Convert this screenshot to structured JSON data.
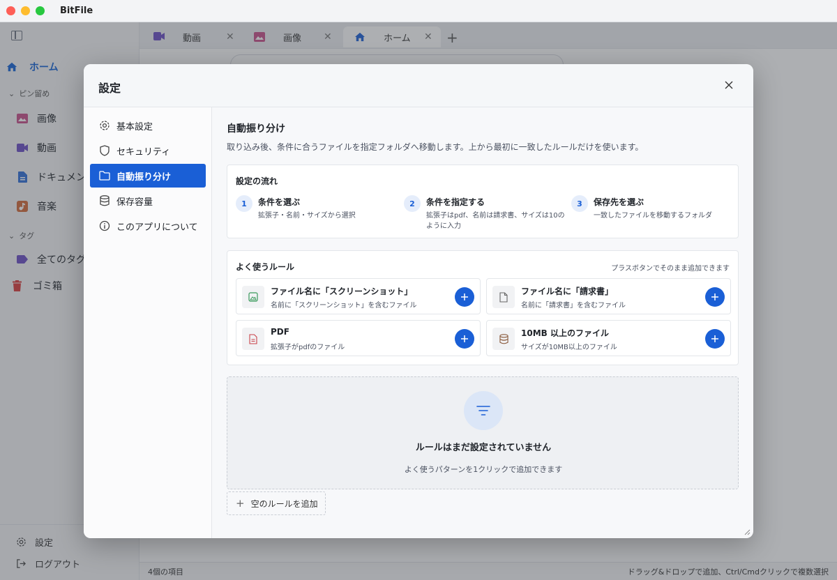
{
  "app": {
    "title": "BitFile"
  },
  "sidebar": {
    "home": "ホーム",
    "pinned_section": "ピン留め",
    "pinned": [
      "画像",
      "動画",
      "ドキュメント",
      "音楽"
    ],
    "tags_section": "タグ",
    "all_tags": "全てのタグ",
    "trash": "ゴミ箱",
    "settings": "設定",
    "logout": "ログアウト"
  },
  "tabs": [
    {
      "label": "動画",
      "icon": "video-icon",
      "color": "#6b4fc4"
    },
    {
      "label": "画像",
      "icon": "image-icon",
      "color": "#c8508a"
    },
    {
      "label": "ホーム",
      "icon": "home-icon",
      "color": "#1a5fd6"
    }
  ],
  "status": {
    "count": "4個の項目",
    "hint": "ドラッグ&ドロップで追加、Ctrl/Cmdクリックで複数選択"
  },
  "settings": {
    "title": "設定",
    "nav": [
      {
        "label": "基本設定",
        "icon": "gear-icon"
      },
      {
        "label": "セキュリティ",
        "icon": "shield-icon"
      },
      {
        "label": "自動振り分け",
        "icon": "folder-icon",
        "active": true
      },
      {
        "label": "保存容量",
        "icon": "database-icon"
      },
      {
        "label": "このアプリについて",
        "icon": "info-icon"
      }
    ],
    "section_title": "自動振り分け",
    "section_desc": "取り込み後、条件に合うファイルを指定フォルダへ移動します。上から最初に一致したルールだけを使います。",
    "flow": {
      "heading": "設定の流れ",
      "steps": [
        {
          "num": "1",
          "title": "条件を選ぶ",
          "desc": "拡張子・名前・サイズから選択"
        },
        {
          "num": "2",
          "title": "条件を指定する",
          "desc": "拡張子はpdf、名前は請求書、サイズは10のように入力"
        },
        {
          "num": "3",
          "title": "保存先を選ぶ",
          "desc": "一致したファイルを移動するフォルダ"
        }
      ]
    },
    "common_rules": {
      "heading": "よく使うルール",
      "hint": "プラスボタンでそのまま追加できます",
      "items": [
        {
          "title": "ファイル名に「スクリーンショット」",
          "desc": "名前に「スクリーンショット」を含むファイル",
          "icon": "image-icon"
        },
        {
          "title": "ファイル名に「請求書」",
          "desc": "名前に「請求書」を含むファイル",
          "icon": "file-icon"
        },
        {
          "title": "PDF",
          "desc": "拡張子がpdfのファイル",
          "icon": "pdf-file-icon"
        },
        {
          "title": "10MB 以上のファイル",
          "desc": "サイズが10MB以上のファイル",
          "icon": "database-icon"
        }
      ]
    },
    "empty_state": {
      "title": "ルールはまだ設定されていません",
      "desc": "よく使うパターンを1クリックで追加できます"
    },
    "add_empty_rule": "空のルールを追加"
  }
}
